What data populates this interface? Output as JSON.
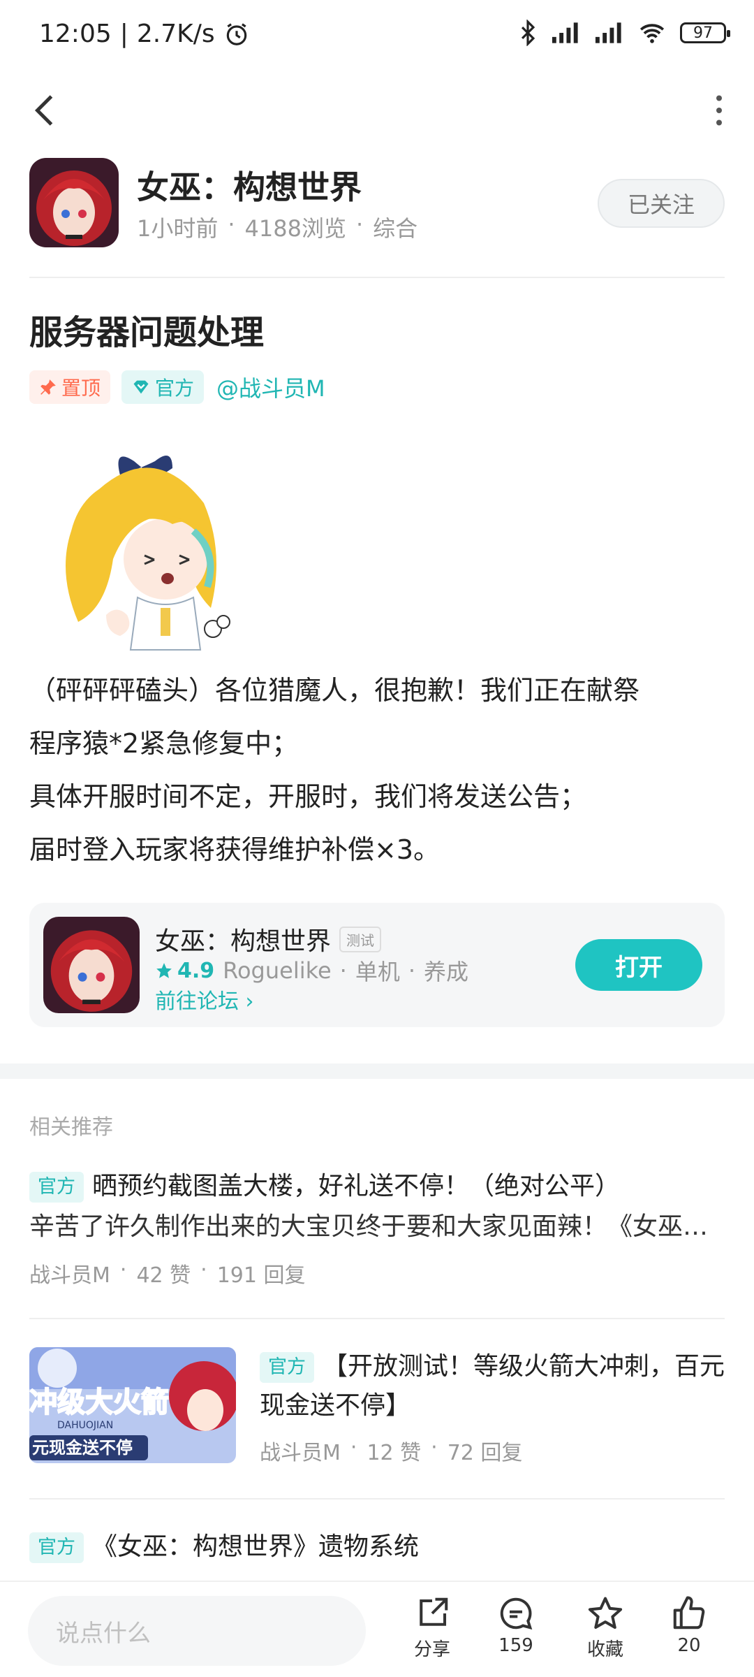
{
  "status_bar": {
    "time": "12:05",
    "speed": "2.7K/s",
    "battery": "97"
  },
  "header": {
    "game_title": "女巫：构想世界",
    "time_ago": "1小时前",
    "views": "4188浏览",
    "category": "综合",
    "follow_label": "已关注"
  },
  "post": {
    "title": "服务器问题处理",
    "tag_top": "置顶",
    "tag_official": "官方",
    "mention": "@战斗员M",
    "body": [
      "（砰砰砰磕头）各位猎魔人，很抱歉！我们正在献祭",
      "程序猿*2紧急修复中；",
      "具体开服时间不定，开服时，我们将发送公告；",
      "届时登入玩家将获得维护补偿×3。"
    ]
  },
  "game_card": {
    "title": "女巫：构想世界",
    "test_badge": "测试",
    "rating": "4.9",
    "genre1": "Roguelike",
    "genre2": "单机",
    "genre3": "养成",
    "forum_link": "前往论坛 ›",
    "open_label": "打开"
  },
  "related": {
    "section_title": "相关推荐",
    "items": [
      {
        "tag": "官方",
        "title": "晒预约截图盖大楼，好礼送不停！（绝对公平）",
        "summary": "辛苦了许久制作出来的大宝贝终于要和大家见面辣！《女巫…",
        "author": "战斗员M",
        "likes": "42 赞",
        "replies": "191 回复"
      },
      {
        "tag": "官方",
        "title": "【开放测试！等级火箭大冲刺，百元现金送不停】",
        "author": "战斗员M",
        "likes": "12 赞",
        "replies": "72 回复",
        "thumb_text1": "冲级大火箭",
        "thumb_text2": "DAHUOJIAN",
        "thumb_text3": "元现金送不停"
      },
      {
        "tag": "官方",
        "title": "《女巫：构想世界》遗物系统"
      }
    ]
  },
  "bottom_bar": {
    "input_placeholder": "说点什么",
    "share_label": "分享",
    "comment_count": "159",
    "favorite_label": "收藏",
    "like_count": "20"
  },
  "colors": {
    "accent": "#1fc4c2",
    "top_tag": "#ff6a4d",
    "text_primary": "#222222",
    "text_muted": "#999999"
  }
}
